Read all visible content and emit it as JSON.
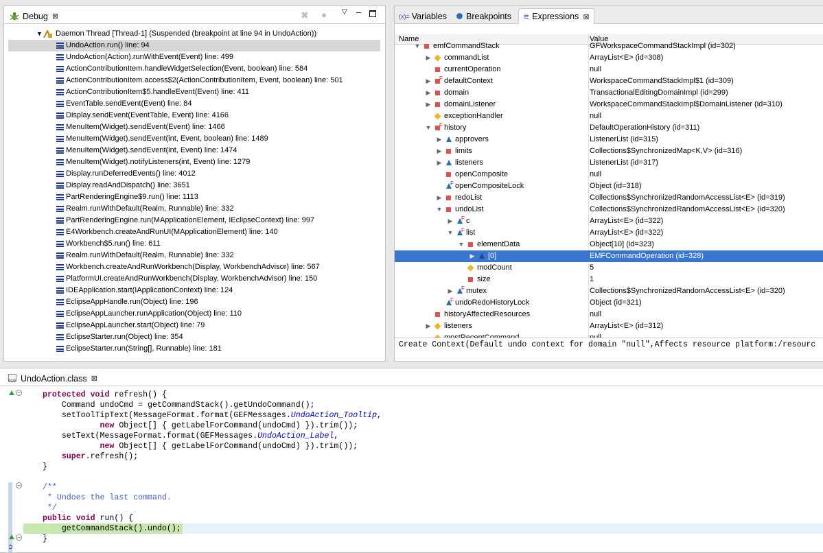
{
  "debug": {
    "tab_label": "Debug",
    "close_glyph": "⊠",
    "thread_label": "Daemon Thread [Thread-1] (Suspended (breakpoint at line 94 in UndoAction))",
    "frames": [
      "UndoAction.run() line: 94",
      "UndoAction(Action).runWithEvent(Event) line: 499",
      "ActionContributionItem.handleWidgetSelection(Event, boolean) line: 584",
      "ActionContributionItem.access$2(ActionContributionItem, Event, boolean) line: 501",
      "ActionContributionItem$5.handleEvent(Event) line: 411",
      "EventTable.sendEvent(Event) line: 84",
      "Display.sendEvent(EventTable, Event) line: 4166",
      "MenuItem(Widget).sendEvent(Event) line: 1466",
      "MenuItem(Widget).sendEvent(int, Event, boolean) line: 1489",
      "MenuItem(Widget).sendEvent(int, Event) line: 1474",
      "MenuItem(Widget).notifyListeners(int, Event) line: 1279",
      "Display.runDeferredEvents() line: 4012",
      "Display.readAndDispatch() line: 3651",
      "PartRenderingEngine$9.run() line: 1113",
      "Realm.runWithDefault(Realm, Runnable) line: 332",
      "PartRenderingEngine.run(MApplicationElement, IEclipseContext) line: 997",
      "E4Workbench.createAndRunUI(MApplicationElement) line: 140",
      "Workbench$5.run() line: 611",
      "Realm.runWithDefault(Realm, Runnable) line: 332",
      "Workbench.createAndRunWorkbench(Display, WorkbenchAdvisor) line: 567",
      "PlatformUI.createAndRunWorkbench(Display, WorkbenchAdvisor) line: 150",
      "IDEApplication.start(IApplicationContext) line: 124",
      "EclipseAppHandle.run(Object) line: 196",
      "EclipseAppLauncher.runApplication(Object) line: 110",
      "EclipseAppLauncher.start(Object) line: 79",
      "EclipseStarter.run(Object) line: 354",
      "EclipseStarter.run(String[], Runnable) line: 181"
    ]
  },
  "views": {
    "tabs": [
      "Variables",
      "Breakpoints",
      "Expressions"
    ],
    "variables_icon": "(x)=",
    "close_glyph": "⊠",
    "col_name": "Name",
    "col_value": "Value",
    "rows": [
      {
        "name": "emfCommandStack",
        "value": "GFWorkspaceCommandStackImpl  (id=302)",
        "depth": 0,
        "tw": "▼",
        "icon": "sq"
      },
      {
        "name": "commandList",
        "value": "ArrayList<E>  (id=308)",
        "depth": 1,
        "tw": "▶",
        "icon": "dia"
      },
      {
        "name": "currentOperation",
        "value": "null",
        "depth": 1,
        "tw": "",
        "icon": "sq"
      },
      {
        "name": "defaultContext",
        "value": "WorkspaceCommandStackImpl$1  (id=309)",
        "depth": 1,
        "tw": "▶",
        "icon": "sqf"
      },
      {
        "name": "domain",
        "value": "TransactionalEditingDomainImpl  (id=299)",
        "depth": 1,
        "tw": "▶",
        "icon": "sq"
      },
      {
        "name": "domainListener",
        "value": "WorkspaceCommandStackImpl$DomainListener  (id=310)",
        "depth": 1,
        "tw": "▶",
        "icon": "sq"
      },
      {
        "name": "exceptionHandler",
        "value": "null",
        "depth": 1,
        "tw": "",
        "icon": "dia"
      },
      {
        "name": "history",
        "value": "DefaultOperationHistory  (id=311)",
        "depth": 1,
        "tw": "▼",
        "icon": "sqf"
      },
      {
        "name": "approvers",
        "value": "ListenerList  (id=315)",
        "depth": 2,
        "tw": "▶",
        "icon": "tri"
      },
      {
        "name": "limits",
        "value": "Collections$SynchronizedMap<K,V>  (id=316)",
        "depth": 2,
        "tw": "▶",
        "icon": "sq"
      },
      {
        "name": "listeners",
        "value": "ListenerList  (id=317)",
        "depth": 2,
        "tw": "▶",
        "icon": "tri"
      },
      {
        "name": "openComposite",
        "value": "null",
        "depth": 2,
        "tw": "",
        "icon": "sq"
      },
      {
        "name": "openCompositeLock",
        "value": "Object  (id=318)",
        "depth": 2,
        "tw": "",
        "icon": "trif"
      },
      {
        "name": "redoList",
        "value": "Collections$SynchronizedRandomAccessList<E>  (id=319)",
        "depth": 2,
        "tw": "▶",
        "icon": "sq"
      },
      {
        "name": "undoList",
        "value": "Collections$SynchronizedRandomAccessList<E>  (id=320)",
        "depth": 2,
        "tw": "▼",
        "icon": "sq"
      },
      {
        "name": "c",
        "value": "ArrayList<E>  (id=322)",
        "depth": 3,
        "tw": "▶",
        "icon": "trif"
      },
      {
        "name": "list",
        "value": "ArrayList<E>  (id=322)",
        "depth": 3,
        "tw": "▼",
        "icon": "trif"
      },
      {
        "name": "elementData",
        "value": "Object[10]  (id=323)",
        "depth": 4,
        "tw": "▼",
        "icon": "sq"
      },
      {
        "name": "[0]",
        "value": "EMFCommandOperation  (id=328)",
        "depth": 5,
        "tw": "▶",
        "icon": "tri",
        "selected": true
      },
      {
        "name": "modCount",
        "value": "5",
        "depth": 4,
        "tw": "",
        "icon": "dia"
      },
      {
        "name": "size",
        "value": "1",
        "depth": 4,
        "tw": "",
        "icon": "sq"
      },
      {
        "name": "mutex",
        "value": "Collections$SynchronizedRandomAccessList<E>  (id=320)",
        "depth": 3,
        "tw": "▶",
        "icon": "trif"
      },
      {
        "name": "undoRedoHistoryLock",
        "value": "Object  (id=321)",
        "depth": 2,
        "tw": "",
        "icon": "trif"
      },
      {
        "name": "historyAffectedResources",
        "value": "null",
        "depth": 1,
        "tw": "",
        "icon": "sq"
      },
      {
        "name": "listeners",
        "value": "ArrayList<E>  (id=312)",
        "depth": 1,
        "tw": "▶",
        "icon": "dia"
      },
      {
        "name": "mostRecentCommand",
        "value": "null",
        "depth": 1,
        "tw": "",
        "icon": "dia"
      }
    ],
    "detail_text": "Create Context(Default undo context for domain \"null\",Affects resource platform:/resourc"
  },
  "editor": {
    "tab_label": "UndoAction.class",
    "close_glyph": "⊠",
    "file_icon": "010",
    "lines": [
      [
        [
          "kw",
          "protected void "
        ],
        [
          "",
          "refresh() {"
        ]
      ],
      [
        [
          "",
          "    Command undoCmd = getCommandStack().getUndoCommand();"
        ]
      ],
      [
        [
          "",
          "    setToolTipText(MessageFormat.format(GEFMessages."
        ],
        [
          "it",
          "UndoAction_Tooltip"
        ],
        [
          "",
          ","
        ]
      ],
      [
        [
          "",
          "            "
        ],
        [
          "kw",
          "new "
        ],
        [
          "",
          "Object[] { getLabelForCommand(undoCmd) }).trim());"
        ]
      ],
      [
        [
          "",
          "    setText(MessageFormat.format(GEFMessages."
        ],
        [
          "it",
          "UndoAction_Label"
        ],
        [
          "",
          ","
        ]
      ],
      [
        [
          "",
          "            "
        ],
        [
          "kw",
          "new "
        ],
        [
          "",
          "Object[] { getLabelForCommand(undoCmd) }).trim());"
        ]
      ],
      [
        [
          "kw",
          "    super"
        ],
        [
          "",
          ".refresh();"
        ]
      ],
      [
        [
          "",
          "}"
        ]
      ],
      [
        [
          "",
          ""
        ]
      ],
      [
        [
          "cm",
          "/**"
        ]
      ],
      [
        [
          "cm",
          " * Undoes the last command."
        ]
      ],
      [
        [
          "cm",
          " */"
        ]
      ],
      [
        [
          "kw",
          "public void "
        ],
        [
          "",
          "run() {"
        ]
      ],
      [
        [
          "",
          "    getCommandStack().undo();"
        ]
      ],
      [
        [
          "",
          "}"
        ]
      ]
    ]
  }
}
